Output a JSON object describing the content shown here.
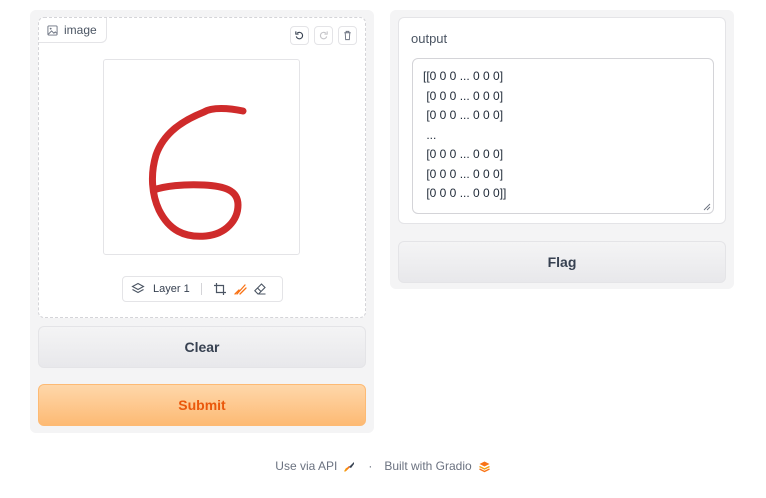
{
  "input": {
    "label": "image",
    "layer_label": "Layer 1",
    "drawing": "handwritten digit 6 in red",
    "stroke_color": "#cf2b2b"
  },
  "buttons": {
    "clear": "Clear",
    "submit": "Submit",
    "flag": "Flag"
  },
  "output": {
    "label": "output",
    "lines": [
      "[[0 0 0 ... 0 0 0]",
      " [0 0 0 ... 0 0 0]",
      " [0 0 0 ... 0 0 0]",
      " ...",
      " [0 0 0 ... 0 0 0]",
      " [0 0 0 ... 0 0 0]",
      " [0 0 0 ... 0 0 0]]"
    ]
  },
  "footer": {
    "api_link": "Use via API",
    "separator": "·",
    "built_with": "Built with Gradio"
  },
  "colors": {
    "accent": "#ea580c",
    "submit_bg": "#fdba74",
    "panel_bg": "#f4f4f5"
  }
}
